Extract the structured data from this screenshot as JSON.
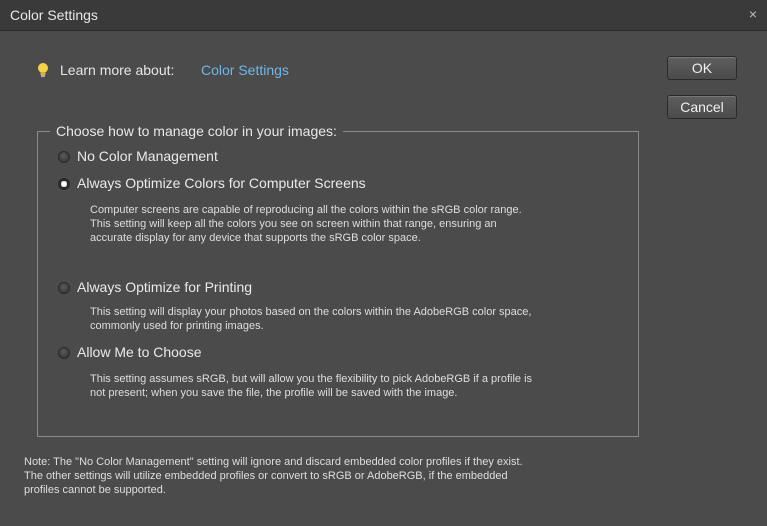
{
  "window": {
    "title": "Color Settings",
    "close_glyph": "×"
  },
  "learn_more": {
    "icon": "lightbulb-icon",
    "label": "Learn more about:",
    "link": "Color Settings",
    "link_color": "#6fb7e7"
  },
  "buttons": {
    "ok": "OK",
    "cancel": "Cancel"
  },
  "group": {
    "legend": "Choose how to manage color in your images:",
    "options": [
      {
        "label": "No Color Management",
        "selected": false,
        "description_lines": []
      },
      {
        "label": "Always Optimize Colors for Computer Screens",
        "selected": true,
        "description_lines": [
          "Computer screens are capable of reproducing all the colors within the sRGB color range.",
          "This setting will keep all the colors you see on screen within that range, ensuring an",
          "accurate display for any device that supports the sRGB color space."
        ]
      },
      {
        "label": "Always Optimize for Printing",
        "selected": false,
        "description_lines": [
          "This setting will display your photos based on the colors within the AdobeRGB color space,",
          "commonly used for printing images."
        ]
      },
      {
        "label": "Allow Me to Choose",
        "selected": false,
        "description_lines": [
          "This setting assumes sRGB, but will allow you the flexibility to pick AdobeRGB if a profile is",
          "not present; when you save the file, the profile will be saved with the image."
        ]
      }
    ]
  },
  "note_lines": [
    "Note: The \"No Color Management\" setting will ignore and discard embedded color profiles if they exist.",
    "The other settings will utilize embedded profiles or convert to sRGB or AdobeRGB, if the embedded",
    "profiles cannot be supported."
  ]
}
